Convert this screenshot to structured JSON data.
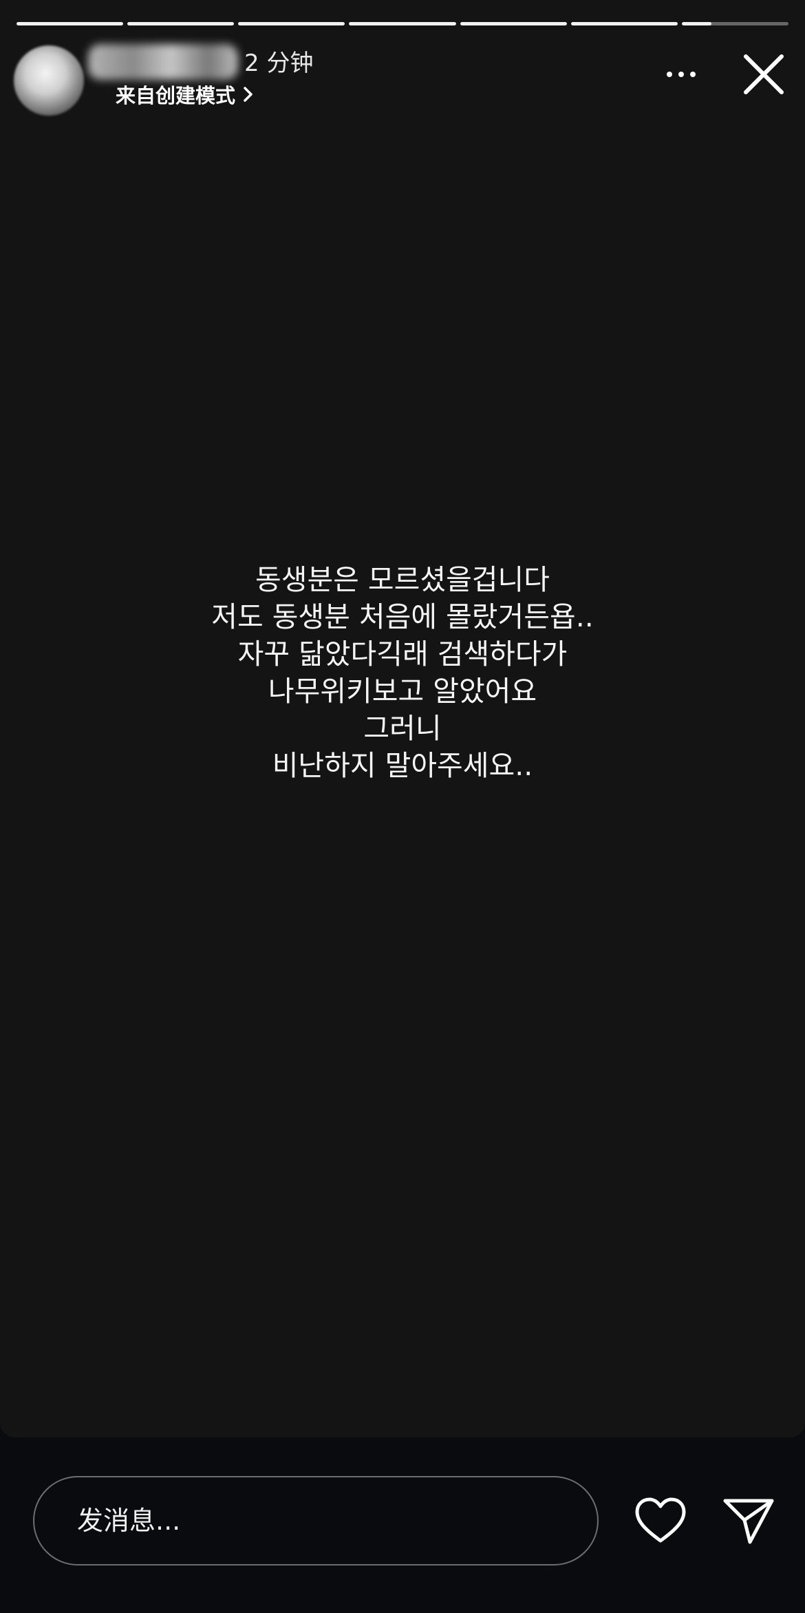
{
  "header": {
    "time_ago": "2 分钟",
    "source_label": "来自创建模式"
  },
  "progress": {
    "total_segments": 7,
    "completed_segments": 6,
    "current_segment_progress": 0.28
  },
  "story": {
    "lines": [
      "동생분은 모르셨을겁니다",
      "저도 동생분 처음에 몰랐거든욥..",
      "자꾸 닮았다긱래 검색하다가",
      "나무위키보고 알았어요",
      "그러니",
      "비난하지 말아주세요.."
    ]
  },
  "composer": {
    "placeholder": "发消息..."
  },
  "icons": {
    "more": "more-horizontal-icon",
    "close": "close-icon",
    "like": "heart-icon",
    "send": "send-icon",
    "source_chevron": "chevron-right-icon"
  },
  "colors": {
    "story_background": "#141414",
    "screen_background": "#090b0f",
    "text": "#ffffff"
  }
}
